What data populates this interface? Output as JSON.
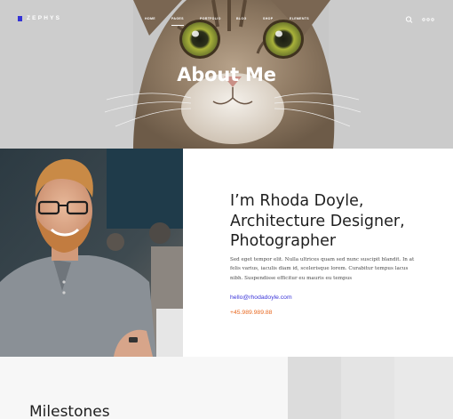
{
  "header": {
    "logo_text": "ZEPHYS",
    "accent_color": "#3533d6",
    "menu": [
      {
        "label": "HOME",
        "active": false
      },
      {
        "label": "PAGES",
        "active": true
      },
      {
        "label": "PORTFOLIO",
        "active": false
      },
      {
        "label": "BLOG",
        "active": false
      },
      {
        "label": "SHOP",
        "active": false
      },
      {
        "label": "ELEMENTS",
        "active": false
      }
    ],
    "icons": [
      "search-icon",
      "more-dots-icon"
    ]
  },
  "hero": {
    "title": "About Me",
    "image": "cat-face-photo"
  },
  "about": {
    "image": "smiling-man-with-glasses-photo",
    "heading_lines": [
      "I’m Rhoda Doyle,",
      "Architecture Designer,",
      "Photographer"
    ],
    "body": "Sed eget tempor elit. Nulla ultrices quam sed nunc suscipit blandit. In at felis varius, iaculis diam id, scelerisque lorem. Curabitur tempus lacus nibh. Suspendisse efficitur eu mauris eu tempus",
    "email": "hello@rhodadoyle.com",
    "phone": "+45.989.989.88",
    "email_color": "#3b35d9",
    "phone_color": "#e8681f"
  },
  "milestones": {
    "title": "Milestones"
  }
}
